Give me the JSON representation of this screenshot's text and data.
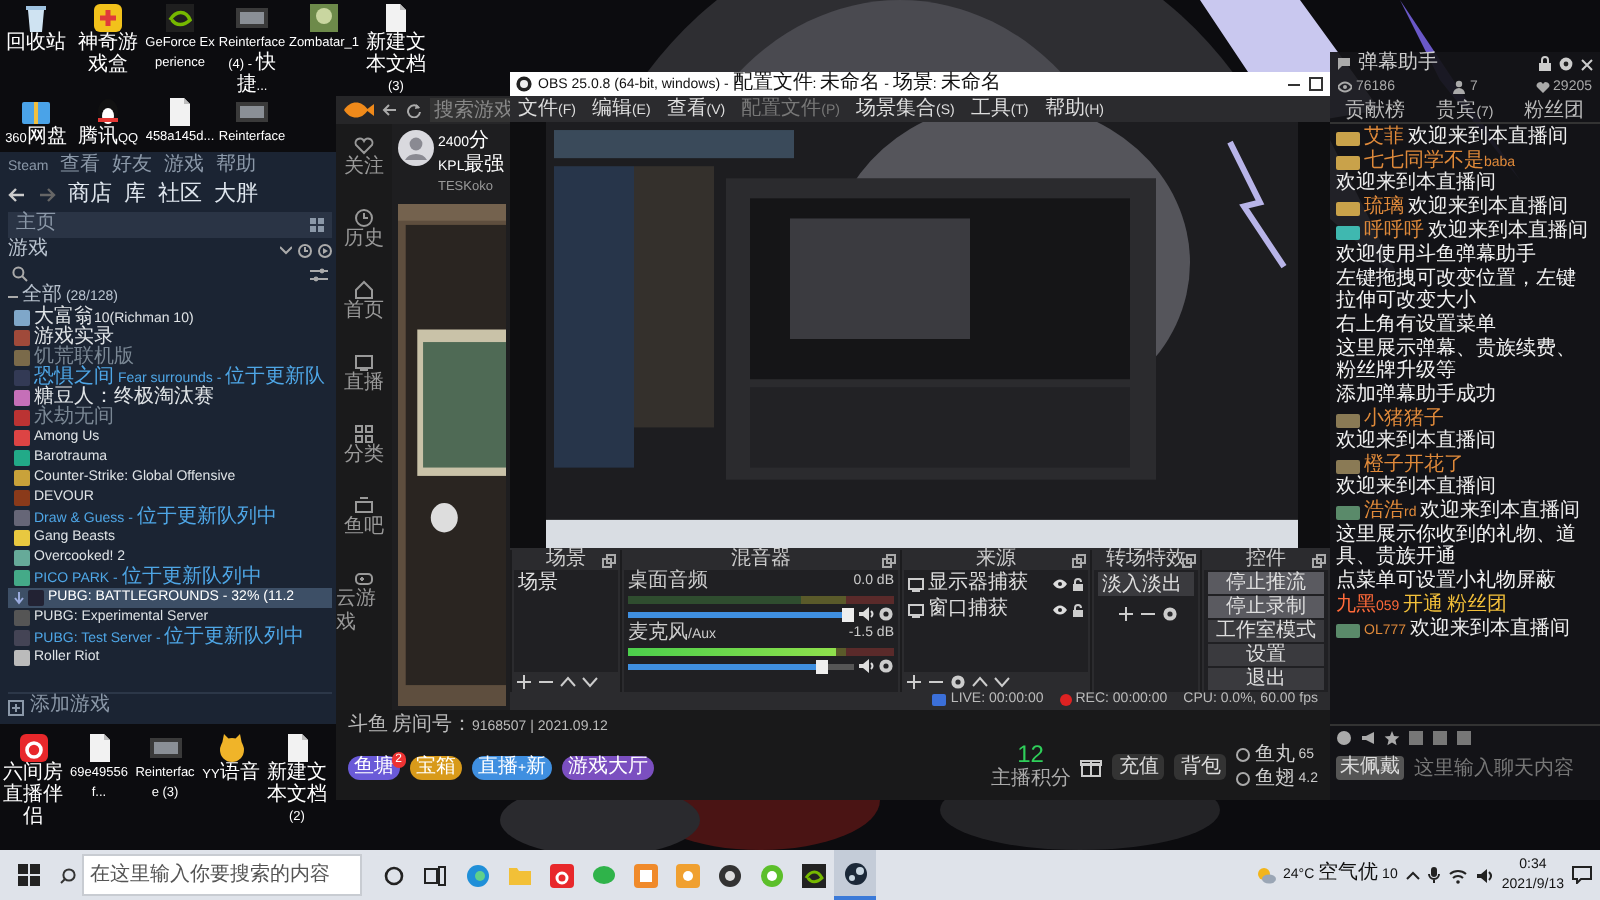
{
  "desktop": {
    "top_icons": [
      {
        "label": "回收站"
      },
      {
        "label": "神奇游戏盒"
      },
      {
        "label": "GeForce Experience"
      },
      {
        "label": "Reinterface (4) - 快捷..."
      },
      {
        "label": "Zombatar_1"
      },
      {
        "label": "新建文本文档 (3)"
      }
    ],
    "second_row_icons": [
      {
        "label": "360网盘"
      },
      {
        "label": "腾讯QQ"
      },
      {
        "label": "458a145d..."
      },
      {
        "label": "Reinterface"
      }
    ],
    "bottom_icons": [
      {
        "label": "六间房直播伴侣"
      },
      {
        "label": "69e49556f..."
      },
      {
        "label": "Reinterface (3)"
      },
      {
        "label": "YY语音"
      },
      {
        "label": "新建文本文档 (2)"
      }
    ]
  },
  "steam": {
    "menu": [
      "Steam",
      "查看",
      "好友",
      "游戏",
      "帮助"
    ],
    "nav": [
      "商店",
      "库",
      "社区",
      "大胖"
    ],
    "home": "主页",
    "filter": "游戏",
    "category": "全部 (28/128)",
    "games": [
      {
        "name": "大富翁10(Richman 10)",
        "kind": "installed",
        "selected": false
      },
      {
        "name": "游戏实录",
        "kind": "installed",
        "selected": false
      },
      {
        "name": "饥荒联机版",
        "kind": "missing",
        "selected": false
      },
      {
        "name": "恐惧之间 Fear surrounds - 位于更新队",
        "kind": "queued",
        "selected": false
      },
      {
        "name": "糖豆人：终极淘汰赛",
        "kind": "installed",
        "selected": false
      },
      {
        "name": "永劫无间",
        "kind": "missing",
        "selected": false
      },
      {
        "name": "Among Us",
        "kind": "installed",
        "selected": false
      },
      {
        "name": "Barotrauma",
        "kind": "installed",
        "selected": false
      },
      {
        "name": "Counter-Strike: Global Offensive",
        "kind": "installed",
        "selected": false
      },
      {
        "name": "DEVOUR",
        "kind": "installed",
        "selected": false
      },
      {
        "name": "Draw & Guess - 位于更新队列中",
        "kind": "queued",
        "selected": false
      },
      {
        "name": "Gang Beasts",
        "kind": "installed",
        "selected": false
      },
      {
        "name": "Overcooked! 2",
        "kind": "installed",
        "selected": false
      },
      {
        "name": "PICO PARK - 位于更新队列中",
        "kind": "queued",
        "selected": false
      },
      {
        "name": "PUBG: BATTLEGROUNDS - 32% (11.2",
        "kind": "downloading",
        "selected": true
      },
      {
        "name": "PUBG: Experimental Server",
        "kind": "installed",
        "selected": false
      },
      {
        "name": "PUBG: Test Server - 位于更新队列中",
        "kind": "queued",
        "selected": false
      },
      {
        "name": "Roller Riot",
        "kind": "installed",
        "selected": false
      }
    ],
    "add_game": "添加游戏"
  },
  "live": {
    "search_placeholder": "搜索游戏",
    "rail": [
      "关注",
      "历史",
      "首页",
      "直播",
      "分类",
      "鱼吧",
      "云游戏"
    ],
    "room_title": "2400分 KPL最强",
    "streamer": "TESKoko",
    "room_info": "斗鱼 房间号：9168507 | 2021.09.12",
    "gifts": [
      {
        "label": "鱼塘",
        "badge": "2"
      },
      {
        "label": "宝箱"
      },
      {
        "label": "直播+新"
      },
      {
        "label": "游戏大厅"
      }
    ],
    "score": "12",
    "score_label": "主播积分",
    "actions": [
      "充值",
      "背包"
    ],
    "balances": [
      {
        "label": "鱼丸",
        "value": "65"
      },
      {
        "label": "鱼翅",
        "value": "4.2"
      }
    ]
  },
  "chat": {
    "title": "弹幕助手",
    "stats": [
      "76186",
      "7",
      "29205"
    ],
    "tabs": [
      "贡献榜",
      "贵宾(7)",
      "粉丝团"
    ],
    "messages": [
      {
        "kind": "welcome",
        "color": "#c9a24a",
        "user": "艾菲",
        "text": "欢迎来到本直播间"
      },
      {
        "kind": "welcome",
        "color": "#c9a24a",
        "user": "七七同学不是baba",
        "text": "欢迎来到本直播间"
      },
      {
        "kind": "welcome",
        "color": "#c9a24a",
        "user": "琉璃",
        "text": "欢迎来到本直播间"
      },
      {
        "kind": "welcome",
        "color": "#3fb8b0",
        "user": "呼呼呼",
        "text": "欢迎来到本直播间"
      },
      {
        "kind": "notice",
        "text": "欢迎使用斗鱼弹幕助手"
      },
      {
        "kind": "notice",
        "text": "左键拖拽可改变位置，左键拉伸可改变大小"
      },
      {
        "kind": "notice",
        "text": "右上角有设置菜单"
      },
      {
        "kind": "notice",
        "text": "这里展示弹幕、贵族续费、粉丝牌升级等"
      },
      {
        "kind": "notice",
        "text": "添加弹幕助手成功"
      },
      {
        "kind": "welcome",
        "color": "#8a7a55",
        "user": "小猪猪子",
        "text": "欢迎来到本直播间"
      },
      {
        "kind": "welcome",
        "color": "#8a7a55",
        "user": "橙子开花了",
        "text": "欢迎来到本直播间"
      },
      {
        "kind": "welcome",
        "color": "#5a8a6a",
        "user": "浩浩rd",
        "text": "欢迎来到本直播间"
      },
      {
        "kind": "notice",
        "text": "这里展示你收到的礼物、道具、贵族开通"
      },
      {
        "kind": "notice",
        "text": "点菜单可设置小礼物屏蔽"
      },
      {
        "kind": "gift",
        "user": "九黑059",
        "text": "开通 粉丝团"
      },
      {
        "kind": "welcome",
        "color": "#5a8a6a",
        "user": "OL777",
        "text": "欢迎来到本直播间"
      }
    ],
    "input_placeholder": "这里输入聊天内容",
    "medal": "未佩戴"
  },
  "obs": {
    "title": "OBS 25.0.8 (64-bit, windows) - 配置文件: 未命名 - 场景: 未命名",
    "menu": [
      {
        "label": "文件(F)",
        "disabled": false
      },
      {
        "label": "编辑(E)",
        "disabled": false
      },
      {
        "label": "查看(V)",
        "disabled": false
      },
      {
        "label": "配置文件(P)",
        "disabled": true
      },
      {
        "label": "场景集合(S)",
        "disabled": false
      },
      {
        "label": "工具(T)",
        "disabled": false
      },
      {
        "label": "帮助(H)",
        "disabled": false
      }
    ],
    "scenes": {
      "title": "场景",
      "items": [
        "场景"
      ]
    },
    "mixer": {
      "title": "混音器",
      "channels": [
        {
          "name": "桌面音频",
          "reading": "0.0 dB",
          "meter": {
            "level": 0
          },
          "volume": {
            "level": 0.97
          }
        },
        {
          "name": "麦克风/Aux",
          "reading": "-1.5 dB",
          "meter": {
            "level": 0.78
          },
          "volume": {
            "level": 0.86
          }
        }
      ]
    },
    "sources": {
      "title": "来源",
      "items": [
        {
          "name": "显示器捕获",
          "visible": true
        },
        {
          "name": "窗口捕获",
          "visible": true
        }
      ]
    },
    "transitions": {
      "title": "转场特效",
      "value": "淡入淡出"
    },
    "controls": {
      "title": "控件",
      "buttons": [
        {
          "label": "停止推流",
          "active": true
        },
        {
          "label": "停止录制",
          "active": true
        },
        {
          "label": "工作室模式",
          "active": false
        },
        {
          "label": "设置",
          "active": false
        },
        {
          "label": "退出",
          "active": false
        }
      ]
    },
    "status": {
      "live": "LIVE: 00:00:00",
      "rec": "REC: 00:00:00",
      "cpu": "CPU: 0.0%, 60.00 fps"
    }
  },
  "taskbar": {
    "search_placeholder": "在这里输入你要搜索的内容",
    "apps": [
      {
        "active": false
      },
      {
        "active": false
      },
      {
        "active": false
      },
      {
        "active": false
      },
      {
        "active": false
      },
      {
        "active": false
      },
      {
        "active": false
      },
      {
        "active": false
      },
      {
        "active": false
      },
      {
        "active": true
      }
    ],
    "weather": "24°C 空气优 10",
    "time": "0:34",
    "date": "2021/9/13"
  }
}
